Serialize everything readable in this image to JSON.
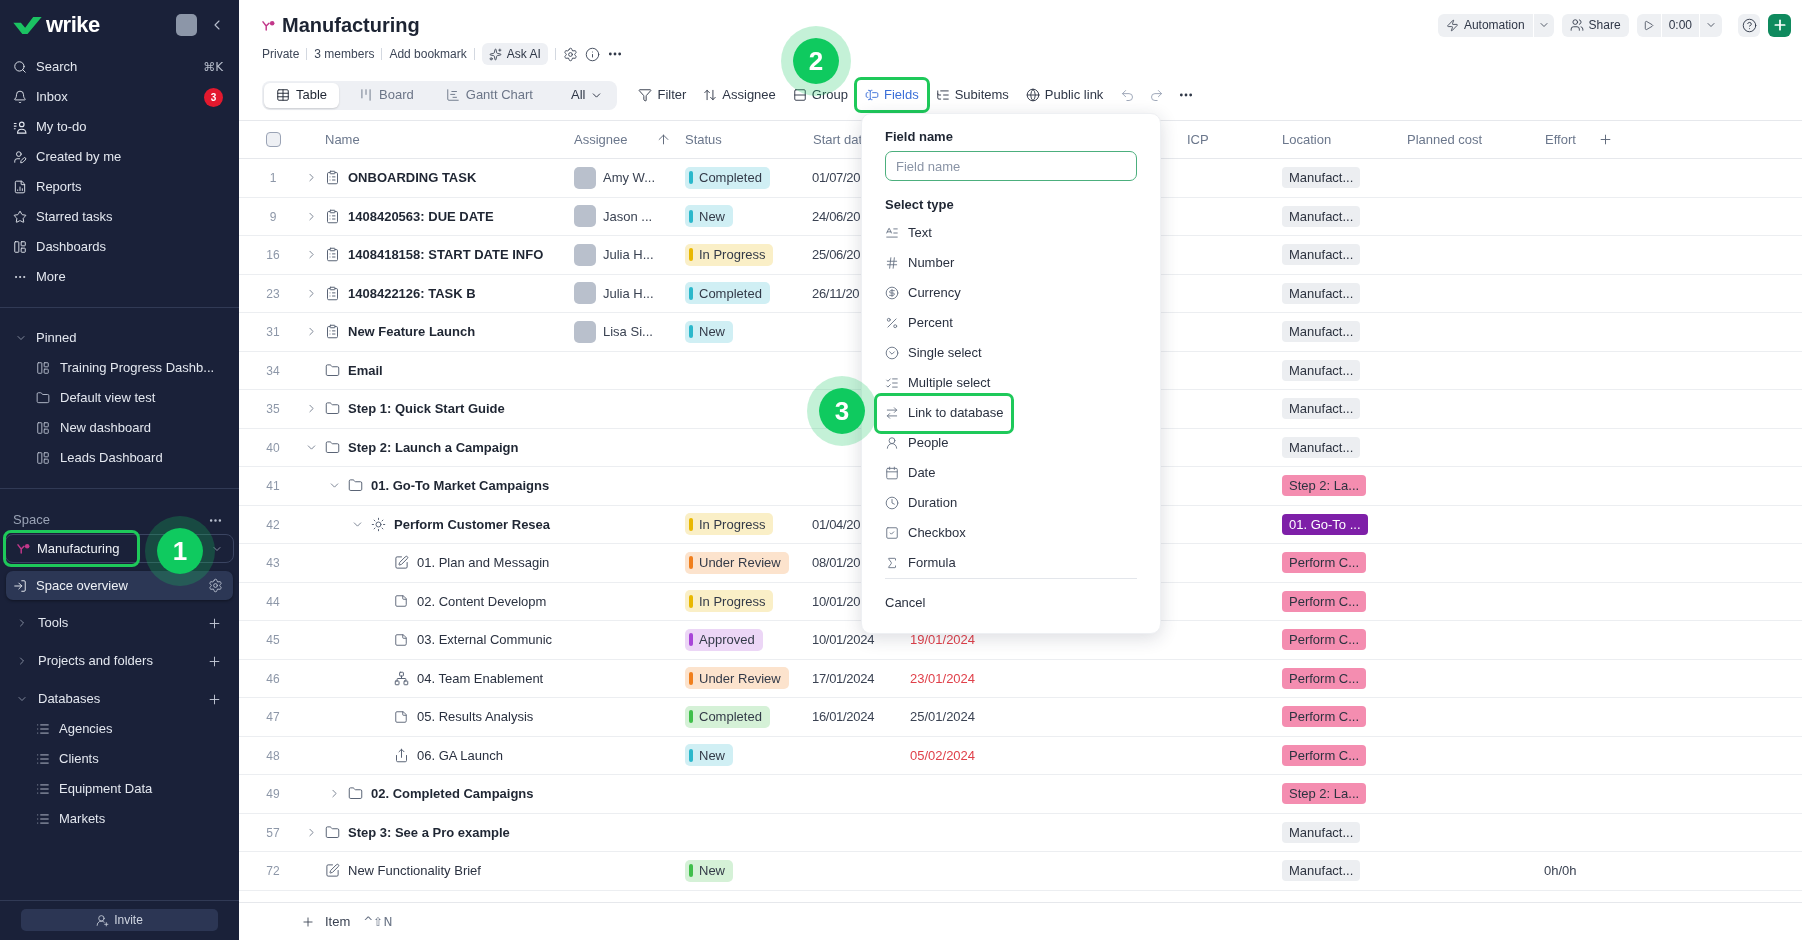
{
  "sidebar": {
    "logo": "wrike",
    "nav": [
      {
        "label": "Search",
        "shortcut": "⌘K"
      },
      {
        "label": "Inbox",
        "badge": "3"
      },
      {
        "label": "My to-do"
      },
      {
        "label": "Created by me"
      },
      {
        "label": "Reports"
      },
      {
        "label": "Starred tasks"
      },
      {
        "label": "Dashboards"
      },
      {
        "label": "More"
      }
    ],
    "pinned": {
      "title": "Pinned",
      "expanded": true,
      "items": [
        {
          "label": "Training Progress Dashb...",
          "kind": "dashboard"
        },
        {
          "label": "Default view test",
          "kind": "folder"
        },
        {
          "label": "New dashboard",
          "kind": "dashboard"
        },
        {
          "label": "Leads Dashboard",
          "kind": "dashboard"
        }
      ]
    },
    "space": {
      "title": "Space",
      "current": {
        "label": "Manufacturing",
        "highlighted": true,
        "callout": "1"
      },
      "overview": {
        "label": "Space overview",
        "selected": true
      }
    },
    "sections": [
      {
        "label": "Tools",
        "expanded": false
      },
      {
        "label": "Projects and folders",
        "expanded": false
      },
      {
        "label": "Databases",
        "expanded": true,
        "children": [
          {
            "label": "Agencies"
          },
          {
            "label": "Clients"
          },
          {
            "label": "Equipment Data"
          },
          {
            "label": "Markets"
          }
        ]
      }
    ],
    "invite": "Invite"
  },
  "header": {
    "title": "Manufacturing",
    "meta": [
      "Private",
      "3 members",
      "Add bookmark"
    ],
    "ask_ai": "Ask AI",
    "automation": "Automation",
    "share": "Share",
    "timer": "0:00"
  },
  "views": {
    "tabs": [
      {
        "label": "Table",
        "selected": true
      },
      {
        "label": "Board",
        "selected": false
      },
      {
        "label": "Gantt Chart",
        "selected": false
      }
    ],
    "filter": "All"
  },
  "toolbar": [
    {
      "label": "Filter",
      "active": false,
      "highlighted": false
    },
    {
      "label": "Assignee",
      "active": false,
      "highlighted": false
    },
    {
      "label": "Group",
      "active": false,
      "highlighted": false
    },
    {
      "label": "Fields",
      "active": true,
      "highlighted": true,
      "callout": "2"
    },
    {
      "label": "Subitems",
      "active": false,
      "highlighted": false
    },
    {
      "label": "Public link",
      "active": false,
      "highlighted": false
    }
  ],
  "field_menu": {
    "title": "Field name",
    "input": {
      "placeholder": "Field name"
    },
    "section": "Select type",
    "types": [
      {
        "label": "Text",
        "highlighted": false
      },
      {
        "label": "Number",
        "highlighted": false
      },
      {
        "label": "Currency",
        "highlighted": false
      },
      {
        "label": "Percent",
        "highlighted": false
      },
      {
        "label": "Single select",
        "highlighted": false
      },
      {
        "label": "Multiple select",
        "highlighted": false
      },
      {
        "label": "Link to database",
        "highlighted": true,
        "callout": "3"
      },
      {
        "label": "People",
        "highlighted": false
      },
      {
        "label": "Date",
        "highlighted": false
      },
      {
        "label": "Duration",
        "highlighted": false
      },
      {
        "label": "Checkbox",
        "highlighted": false
      },
      {
        "label": "Formula",
        "highlighted": false
      }
    ],
    "cancel": "Cancel"
  },
  "table": {
    "select_all": {
      "checked": false
    },
    "columns": [
      {
        "label": "Name"
      },
      {
        "label": "Assignee",
        "sorted": true
      },
      {
        "label": "Status"
      },
      {
        "label": "Start dat"
      },
      {
        "label": "ICP"
      },
      {
        "label": "Location"
      },
      {
        "label": "Planned cost"
      },
      {
        "label": "Effort"
      }
    ],
    "rows": [
      {
        "number": "1",
        "kind": "task",
        "name": "ONBOARDING TASK",
        "expanded": false,
        "assignee": "Amy W...",
        "status": {
          "label": "Completed",
          "color": "#2bb8cb"
        },
        "start_date": "01/07/20",
        "location": {
          "label": "Manufact...",
          "color": "#eceef1"
        }
      },
      {
        "number": "9",
        "kind": "task",
        "name": "1408420563: DUE DATE",
        "expanded": false,
        "assignee": "Jason ...",
        "status": {
          "label": "New",
          "color": "#2bb8cb"
        },
        "start_date": "24/06/20",
        "location": {
          "label": "Manufact...",
          "color": "#eceef1"
        }
      },
      {
        "number": "16",
        "kind": "task",
        "name": "1408418158: START DATE INFO",
        "expanded": false,
        "assignee": "Julia H...",
        "status": {
          "label": "In Progress",
          "color": "#e9b800"
        },
        "start_date": "25/06/20",
        "location": {
          "label": "Manufact...",
          "color": "#eceef1"
        }
      },
      {
        "number": "23",
        "kind": "task",
        "name": "1408422126: TASK B",
        "expanded": false,
        "assignee": "Julia H...",
        "status": {
          "label": "Completed",
          "color": "#2bb8cb"
        },
        "start_date": "26/11/20",
        "location": {
          "label": "Manufact...",
          "color": "#eceef1"
        }
      },
      {
        "number": "31",
        "kind": "task",
        "name": "New Feature Launch",
        "expanded": false,
        "assignee": "Lisa Si...",
        "status": {
          "label": "New",
          "color": "#2bb8cb"
        },
        "location": {
          "label": "Manufact...",
          "color": "#eceef1"
        }
      },
      {
        "number": "34",
        "kind": "folder",
        "name": "Email",
        "location": {
          "label": "Manufact...",
          "color": "#eceef1"
        }
      },
      {
        "number": "35",
        "kind": "folder",
        "name": "Step 1: Quick Start Guide",
        "expanded": false,
        "location": {
          "label": "Manufact...",
          "color": "#eceef1"
        }
      },
      {
        "number": "40",
        "kind": "folder",
        "name": "Step 2: Launch a Campaign",
        "expanded": true,
        "location": {
          "label": "Manufact...",
          "color": "#eceef1"
        },
        "children": [
          {
            "number": "41",
            "kind": "folder",
            "name": "01. Go-To Market Campaigns",
            "expanded": true,
            "location": {
              "label": "Step 2: La...",
              "color": "#f48db0"
            },
            "children": [
              {
                "number": "42",
                "kind": "project",
                "name": "Perform Customer Resea",
                "expanded": true,
                "status": {
                  "label": "In Progress",
                  "color": "#e9b800"
                },
                "start_date": "01/04/20",
                "location": {
                  "label": "01. Go-To ...",
                  "color": "#7e1fa8"
                },
                "children": [
                  {
                    "number": "43",
                    "kind": "brief",
                    "name": "01. Plan and Messagin",
                    "status": {
                      "label": "Under Review",
                      "color": "#f07f1d"
                    },
                    "start_date": "08/01/20",
                    "location": {
                      "label": "Perform C...",
                      "color": "#f48db0"
                    }
                  },
                  {
                    "number": "44",
                    "kind": "note",
                    "name": "02. Content Developm",
                    "status": {
                      "label": "In Progress",
                      "color": "#e9b800"
                    },
                    "start_date": "10/01/20",
                    "location": {
                      "label": "Perform C...",
                      "color": "#f48db0"
                    }
                  },
                  {
                    "number": "45",
                    "kind": "note",
                    "name": "03. External Communic",
                    "status": {
                      "label": "Approved",
                      "color": "#a845d8"
                    },
                    "start_date": "10/01/2024",
                    "column_5": {
                      "text": "19/01/2024",
                      "overdue": true
                    },
                    "location": {
                      "label": "Perform C...",
                      "color": "#f48db0"
                    }
                  },
                  {
                    "number": "46",
                    "kind": "team",
                    "name": "04. Team Enablement",
                    "status": {
                      "label": "Under Review",
                      "color": "#f07f1d"
                    },
                    "start_date": "17/01/2024",
                    "column_5": {
                      "text": "23/01/2024",
                      "overdue": true
                    },
                    "location": {
                      "label": "Perform C...",
                      "color": "#f48db0"
                    }
                  },
                  {
                    "number": "47",
                    "kind": "note",
                    "name": "05. Results Analysis",
                    "status": {
                      "label": "Completed",
                      "color": "#3fbf4a"
                    },
                    "start_date": "16/01/2024",
                    "column_5": {
                      "text": "25/01/2024",
                      "overdue": false
                    },
                    "location": {
                      "label": "Perform C...",
                      "color": "#f48db0"
                    }
                  },
                  {
                    "number": "48",
                    "kind": "launch",
                    "name": "06. GA Launch",
                    "status": {
                      "label": "New",
                      "color": "#2bb8cb"
                    },
                    "column_5": {
                      "text": "05/02/2024",
                      "overdue": true
                    },
                    "location": {
                      "label": "Perform C...",
                      "color": "#f48db0"
                    }
                  }
                ]
              }
            ]
          },
          {
            "number": "49",
            "kind": "folder",
            "name": "02. Completed Campaigns",
            "expanded": false,
            "location": {
              "label": "Step 2: La...",
              "color": "#f48db0"
            }
          }
        ]
      },
      {
        "number": "57",
        "kind": "folder",
        "name": "Step 3: See a Pro example",
        "expanded": false,
        "location": {
          "label": "Manufact...",
          "color": "#eceef1"
        }
      },
      {
        "number": "72",
        "kind": "brief",
        "name": "New Functionality Brief",
        "status": {
          "label": "New",
          "color": "#3fbf4a"
        },
        "location": {
          "label": "Manufact...",
          "color": "#eceef1"
        },
        "effort": "0h/0h"
      }
    ]
  },
  "footer": {
    "label": "Item",
    "shortcut": "^⇧N"
  }
}
